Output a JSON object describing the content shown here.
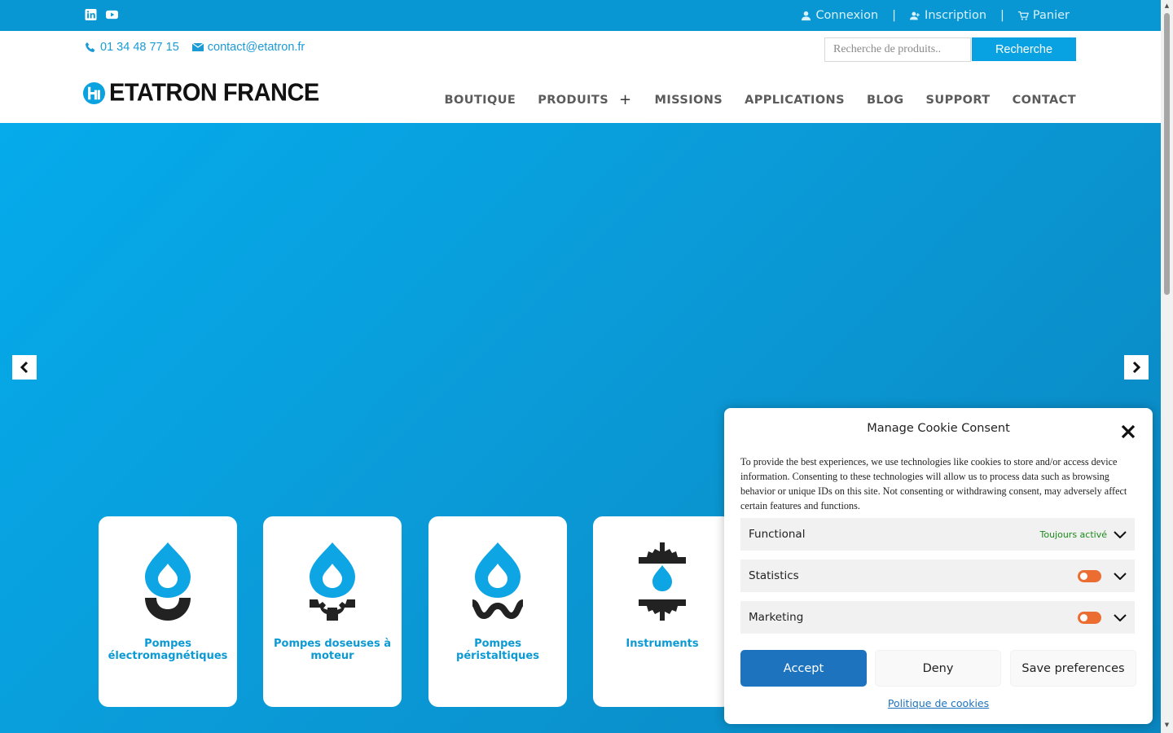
{
  "topbar": {
    "login_label": "Connexion",
    "register_label": "Inscription",
    "cart_label": "Panier",
    "separator": "|"
  },
  "contact": {
    "phone": "01 34 48 77 15",
    "email": "contact@etatron.fr"
  },
  "search": {
    "placeholder": "Recherche de produits..",
    "button_label": "Recherche"
  },
  "brand": {
    "name": "ETATRON FRANCE"
  },
  "nav": {
    "items": [
      {
        "label": "BOUTIQUE"
      },
      {
        "label": "PRODUITS"
      },
      {
        "label": "MISSIONS"
      },
      {
        "label": "APPLICATIONS"
      },
      {
        "label": "BLOG"
      },
      {
        "label": "SUPPORT"
      },
      {
        "label": "CONTACT"
      }
    ],
    "produits_expand": "+"
  },
  "product_cards": [
    {
      "label": "Pompes électromagnétiques",
      "icon": "drop-magnet-icon"
    },
    {
      "label": "Pompes doseuses à moteur",
      "icon": "drop-gear-icon"
    },
    {
      "label": "Pompes péristaltiques",
      "icon": "drop-wave-icon"
    },
    {
      "label": "Instruments",
      "icon": "gear-drop-icon"
    }
  ],
  "cookie": {
    "title": "Manage Cookie Consent",
    "body": "To provide the best experiences, we use technologies like cookies to store and/or access device information. Consenting to these technologies will allow us to process data such as browsing behavior or unique IDs on this site. Not consenting or withdrawing consent, may adversely affect certain features and functions.",
    "categories": [
      {
        "name": "Functional",
        "status": "Toujours activé"
      },
      {
        "name": "Statistics"
      },
      {
        "name": "Marketing"
      }
    ],
    "accept_label": "Accept",
    "deny_label": "Deny",
    "save_label": "Save preferences",
    "policy_label": "Politique de cookies"
  },
  "colors": {
    "brand_blue": "#0897d2",
    "accent_button": "#08a2e2",
    "accept_blue": "#1e73be",
    "toggle_orange": "#eb6d31"
  }
}
